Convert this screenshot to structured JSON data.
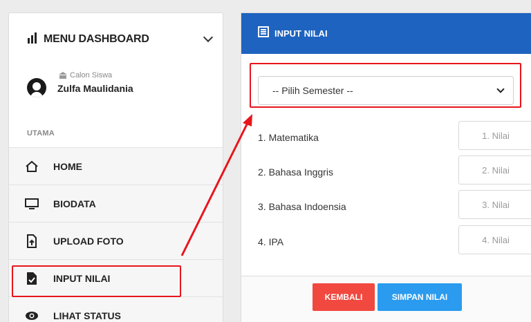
{
  "sidebar": {
    "menu_title": "MENU DASHBOARD",
    "user_role": "Calon Siswa",
    "user_name": "Zulfa Maulidania",
    "section_label": "UTAMA",
    "items": [
      {
        "label": "HOME",
        "icon": "home-icon"
      },
      {
        "label": "BIODATA",
        "icon": "monitor-icon"
      },
      {
        "label": "UPLOAD FOTO",
        "icon": "file-upload-icon"
      },
      {
        "label": "INPUT NILAI",
        "icon": "file-check-icon"
      },
      {
        "label": "LIHAT STATUS",
        "icon": "eye-icon"
      }
    ]
  },
  "panel": {
    "title": "INPUT NILAI",
    "select_value": "-- Pilih Semester --",
    "subjects": [
      {
        "label": "1. Matematika",
        "placeholder": "1. Nilai"
      },
      {
        "label": "2. Bahasa Inggris",
        "placeholder": "2. Nilai"
      },
      {
        "label": "3. Bahasa Indoensia",
        "placeholder": "3. Nilai"
      },
      {
        "label": "4. IPA",
        "placeholder": "4. Nilai"
      }
    ],
    "back_label": "KEMBALI",
    "save_label": "SIMPAN NILAI"
  },
  "colors": {
    "header_blue": "#1e63bf",
    "back_red": "#f1483f",
    "save_blue": "#2a9bef",
    "annotation_red": "#e8151b"
  }
}
